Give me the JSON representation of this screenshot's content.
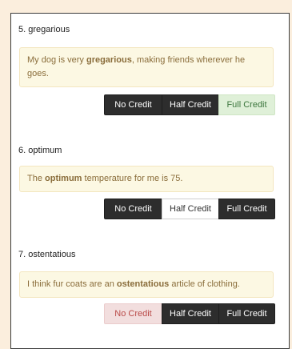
{
  "items": [
    {
      "title": "5. gregarious",
      "sentence_before": "My dog is very ",
      "sentence_bold": "gregarious",
      "sentence_after": ", making friends wherever he goes.",
      "buttons": {
        "no_credit": "No Credit",
        "half_credit": "Half Credit",
        "full_credit": "Full Credit"
      },
      "selected": "full_credit"
    },
    {
      "title": "6. optimum",
      "sentence_before": "The ",
      "sentence_bold": "optimum",
      "sentence_after": " temperature for me is 75.",
      "buttons": {
        "no_credit": "No Credit",
        "half_credit": "Half Credit",
        "full_credit": "Full Credit"
      },
      "selected": "half_credit"
    },
    {
      "title": "7. ostentatious",
      "sentence_before": "I think fur coats are an ",
      "sentence_bold": "ostentatious",
      "sentence_after": " article of clothing.",
      "buttons": {
        "no_credit": "No Credit",
        "half_credit": "Half Credit",
        "full_credit": "Full Credit"
      },
      "selected": "no_credit"
    }
  ],
  "colors": {
    "page_background": "#fbeedd",
    "selected_full": "#dff0d8",
    "selected_half": "#ffffff",
    "selected_no": "#f2dede",
    "unselected": "#2d2d2d"
  }
}
